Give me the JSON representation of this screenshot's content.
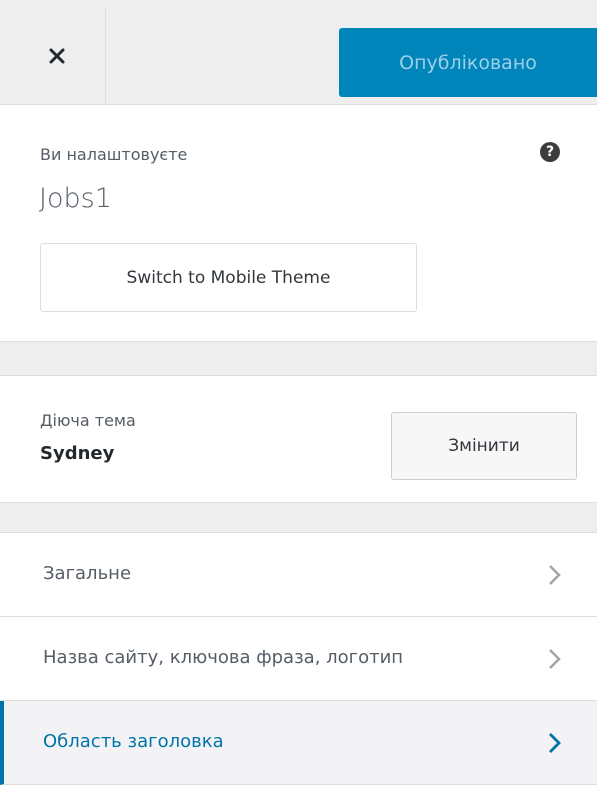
{
  "header": {
    "close_icon": "close-icon",
    "publish_label": "Опубліковано",
    "publish_color": "#0085ba"
  },
  "info": {
    "customizing_label": "Ви налаштовуєте",
    "site_name": "Jobs1",
    "help_icon": "question-circle-icon",
    "mobile_theme_button": "Switch to Mobile Theme"
  },
  "theme": {
    "label": "Діюча тема",
    "name": "Sydney",
    "change_button": "Змінити"
  },
  "sections": {
    "items": [
      {
        "label": "Загальне",
        "icon": "chevron-right-icon",
        "active": false
      },
      {
        "label": "Назва сайту, ключова фраза, логотип",
        "icon": "chevron-right-icon",
        "active": false
      },
      {
        "label": "Область заголовка",
        "icon": "chevron-right-icon",
        "active": true
      }
    ],
    "active_color": "#0073aa"
  }
}
